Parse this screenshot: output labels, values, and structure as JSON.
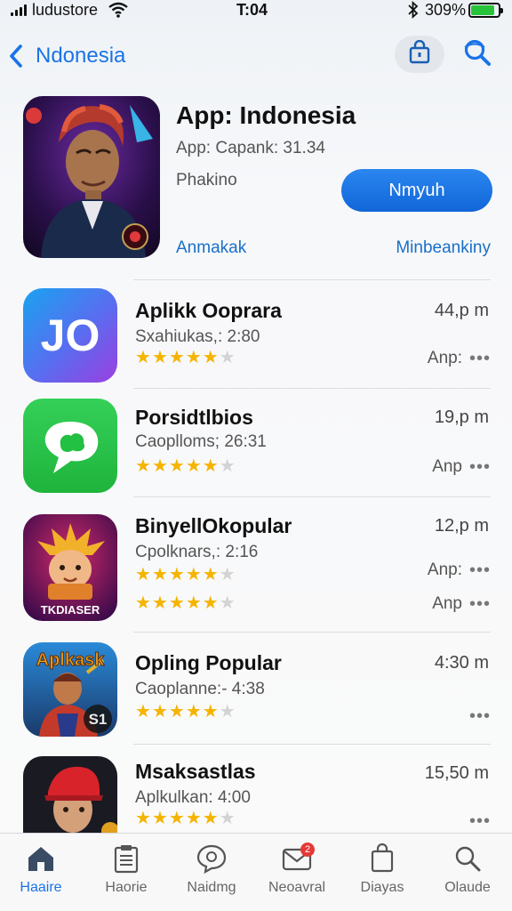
{
  "status_bar": {
    "carrier": "ludustore",
    "time": "T:04",
    "battery_pct": "309%",
    "battery_color": "#27c33b"
  },
  "nav": {
    "back_label": "Ndonesia",
    "accent_color": "#1a73e8"
  },
  "featured": {
    "title": "App: Indonesia",
    "subtitle": "App: Capank: 31.34",
    "meta": "Phakino",
    "get_label": "Nmyuh",
    "link_left": "Anmakak",
    "link_right": "Minbeankiny"
  },
  "apps": [
    {
      "name": "Aplikk Ooprara",
      "sub": "Sxahiukas,: 2:80",
      "size": "44,p m",
      "tag": "Anp:",
      "rating": 5,
      "icon_text": "JO"
    },
    {
      "name": "Porsidtlbios",
      "sub": "Caoplloms; 26:31",
      "size": "19,p m",
      "tag": "Anp",
      "rating": 5
    },
    {
      "name": "BinyellOkopular",
      "sub": "Cpolknars,: 2:16",
      "size": "12,p m",
      "tag": "Anp:",
      "tag2": "Anp",
      "rating": 5,
      "rating2": 5,
      "icon_text": "TKDIASER"
    },
    {
      "name": "Opling Popular",
      "sub": "Caoplanne:- 4:38",
      "size": "4:30 m",
      "rating": 5,
      "icon_text": "Aplkask",
      "icon_text2": "S1"
    },
    {
      "name": "Msaksastlas",
      "sub": "Aplkulkan: 4:00",
      "size": "15,50 m",
      "rating": 5
    }
  ],
  "tabs": [
    {
      "label": "Haaire",
      "icon": "home-icon",
      "active": true
    },
    {
      "label": "Haorie",
      "icon": "clipboard-icon"
    },
    {
      "label": "Naidmg",
      "icon": "chat-icon"
    },
    {
      "label": "Neoavral",
      "icon": "mail-icon",
      "badge": "2"
    },
    {
      "label": "Diayas",
      "icon": "bag-icon"
    },
    {
      "label": "Olaude",
      "icon": "search-icon"
    }
  ]
}
